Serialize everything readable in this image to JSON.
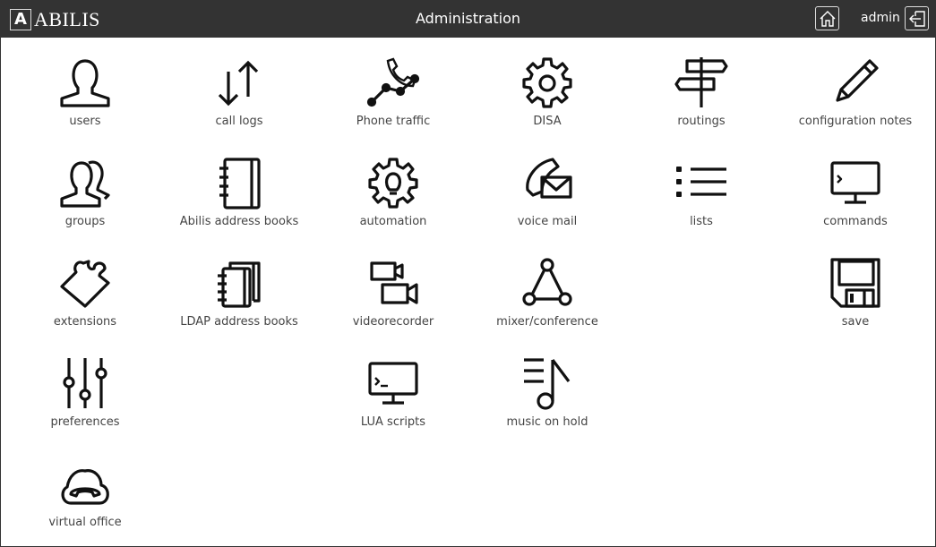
{
  "header": {
    "logo_letter": "A",
    "logo_text": "ABILIS",
    "title": "Administration",
    "user": "admin",
    "home_icon": "home-icon",
    "logout_icon": "logout-icon"
  },
  "tiles": [
    {
      "id": "users",
      "label": "users",
      "icon": "user-icon"
    },
    {
      "id": "call-logs",
      "label": "call logs",
      "icon": "arrows-updown-icon"
    },
    {
      "id": "phone-traffic",
      "label": "Phone traffic",
      "icon": "phone-chart-icon"
    },
    {
      "id": "disa",
      "label": "DISA",
      "icon": "gear-icon"
    },
    {
      "id": "routings",
      "label": "routings",
      "icon": "signpost-icon"
    },
    {
      "id": "configuration-notes",
      "label": "configuration notes",
      "icon": "pencil-icon"
    },
    {
      "id": "groups",
      "label": "groups",
      "icon": "users-icon"
    },
    {
      "id": "abilis-address-books",
      "label": "Abilis address books",
      "icon": "address-book-icon"
    },
    {
      "id": "automation",
      "label": "automation",
      "icon": "gear-bulb-icon"
    },
    {
      "id": "voice-mail",
      "label": "voice mail",
      "icon": "phone-envelope-icon"
    },
    {
      "id": "lists",
      "label": "lists",
      "icon": "list-icon"
    },
    {
      "id": "commands",
      "label": "commands",
      "icon": "monitor-prompt-icon"
    },
    {
      "id": "extensions",
      "label": "extensions",
      "icon": "puzzle-icon"
    },
    {
      "id": "ldap-address-books",
      "label": "LDAP address books",
      "icon": "address-books-icon"
    },
    {
      "id": "videorecorder",
      "label": "videorecorder",
      "icon": "video-cameras-icon"
    },
    {
      "id": "mixer-conference",
      "label": "mixer/conference",
      "icon": "triangle-nodes-icon"
    },
    {
      "id": "save",
      "label": "save",
      "icon": "floppy-icon"
    },
    {
      "id": "preferences",
      "label": "preferences",
      "icon": "sliders-icon"
    },
    {
      "id": "lua-scripts",
      "label": "LUA scripts",
      "icon": "monitor-terminal-icon"
    },
    {
      "id": "music-on-hold",
      "label": "music on hold",
      "icon": "music-note-icon"
    },
    {
      "id": "virtual-office",
      "label": "virtual office",
      "icon": "cloud-phone-icon"
    }
  ]
}
